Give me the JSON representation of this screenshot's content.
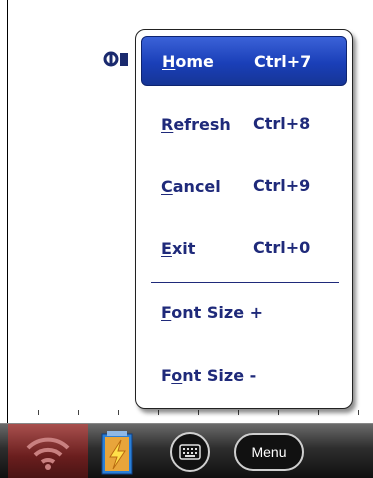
{
  "menu": {
    "items": [
      {
        "accel": "H",
        "rest": "ome",
        "shortcut": "Ctrl+7",
        "selected": true
      },
      {
        "accel": "R",
        "rest": "efresh",
        "shortcut": "Ctrl+8"
      },
      {
        "accel": "C",
        "rest": "ancel",
        "shortcut": "Ctrl+9"
      },
      {
        "accel": "E",
        "rest": "xit",
        "shortcut": "Ctrl+0"
      },
      {
        "pre": "",
        "accel": "F",
        "rest": "ont Size +"
      },
      {
        "pre": "F",
        "accel": "o",
        "rest": "nt Size -"
      }
    ]
  },
  "taskbar": {
    "menu_button_label": "Menu"
  },
  "icons": {
    "wifi": "wifi-icon",
    "battery": "battery-charging-icon",
    "keyboard": "keyboard-icon"
  },
  "colors": {
    "menu_text": "#1f2a7a",
    "selected_bg": "#1a3fb8",
    "wifi_slot": "#7a2a2a"
  }
}
